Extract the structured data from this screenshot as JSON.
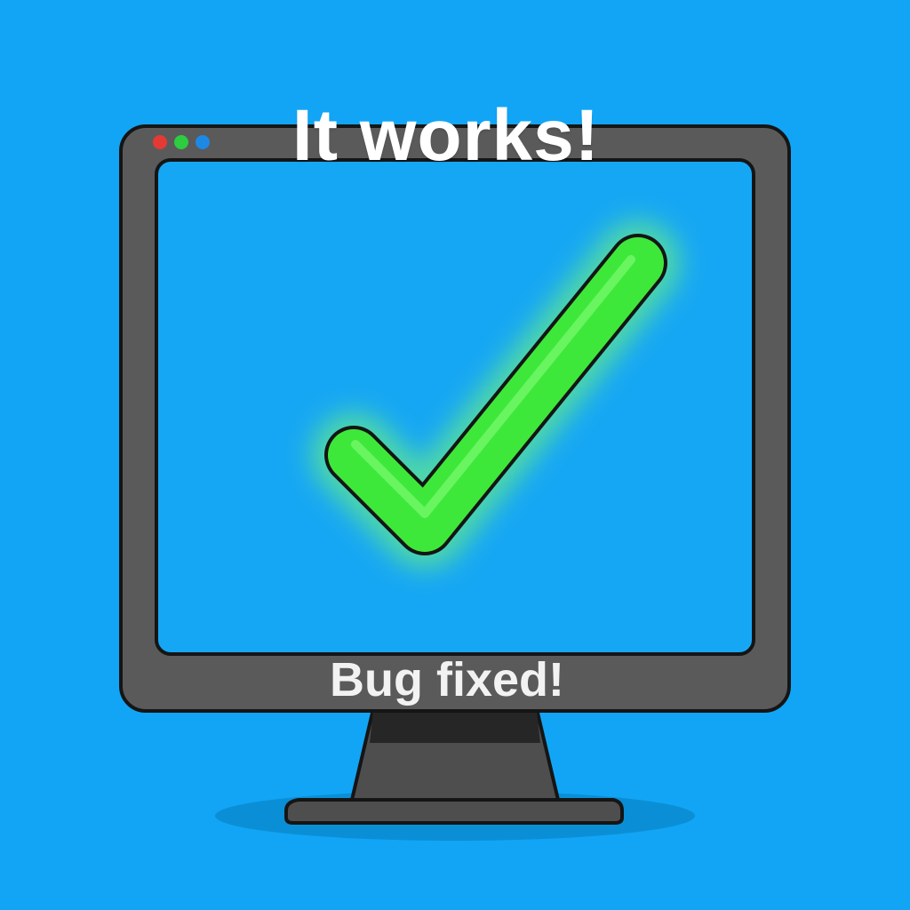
{
  "headline": "It works!",
  "caption": "Bug fixed!",
  "window_dots": [
    {
      "name": "red",
      "color": "#e53935"
    },
    {
      "name": "green",
      "color": "#2ecc40"
    },
    {
      "name": "blue",
      "color": "#1e88e5"
    }
  ],
  "icon": "checkmark-icon",
  "colors": {
    "background": "#12a5f5",
    "screen": "#16a7f4",
    "bezel": "#5a5a5a",
    "outline": "#151515",
    "check": "#3ee83a",
    "check_glow": "#7dff6a"
  }
}
